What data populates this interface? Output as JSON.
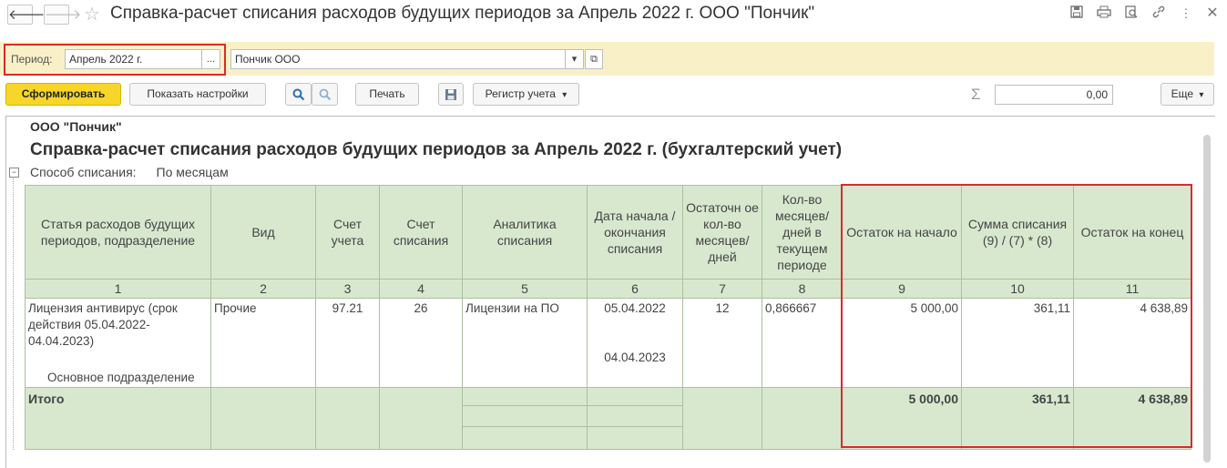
{
  "window": {
    "title": "Справка-расчет списания расходов будущих периодов за Апрель 2022 г. ООО \"Пончик\""
  },
  "filters": {
    "period_label": "Период:",
    "period_value": "Апрель 2022 г.",
    "period_more": "...",
    "org_value": "Пончик ООО"
  },
  "toolbar": {
    "generate": "Сформировать",
    "show_settings": "Показать настройки",
    "print": "Печать",
    "register": "Регистр учета",
    "sum_value": "0,00",
    "more": "Еще"
  },
  "report": {
    "org": "ООО \"Пончик\"",
    "title": "Справка-расчет списания расходов будущих периодов за Апрель 2022 г. (бухгалтерский учет)",
    "method_label": "Способ списания:",
    "method_value": "По месяцам",
    "headers": [
      "Статья расходов будущих периодов, подразделение",
      "Вид",
      "Счет учета",
      "Счет списания",
      "Аналитика списания",
      "Дата начала / окончания списания",
      "Остаточн ое кол-во месяцев/ дней",
      "Кол-во месяцев/ дней в текущем периоде",
      "Остаток на начало",
      "Сумма списания (9) / (7) * (8)",
      "Остаток на конец"
    ],
    "col_numbers": [
      "1",
      "2",
      "3",
      "4",
      "5",
      "6",
      "7",
      "8",
      "9",
      "10",
      "11"
    ],
    "row": {
      "article": "Лицензия антивирус (срок действия 05.04.2022-04.04.2023)",
      "department": "Основное подразделение",
      "kind": "Прочие",
      "account": "97.21",
      "write_off_account": "26",
      "analytics": "Лицензии на ПО",
      "date_start": "05.04.2022",
      "date_end": "04.04.2023",
      "remaining": "12",
      "current": "0,866667",
      "begin_balance": "5 000,00",
      "write_off_sum": "361,11",
      "end_balance": "4 638,89"
    },
    "total": {
      "label": "Итого",
      "begin_balance": "5 000,00",
      "write_off_sum": "361,11",
      "end_balance": "4 638,89"
    }
  }
}
